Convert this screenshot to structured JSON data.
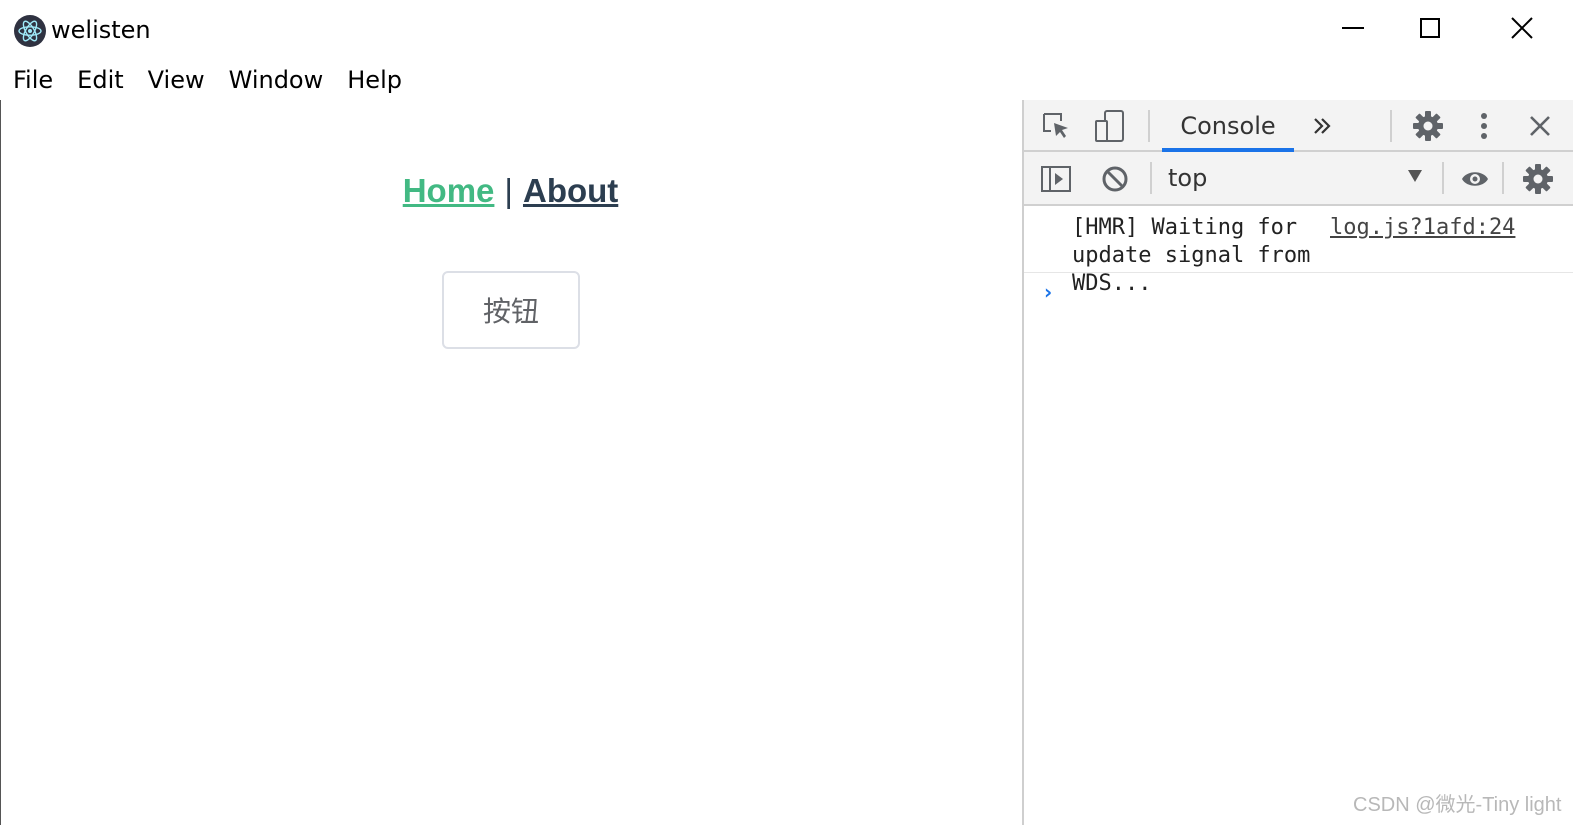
{
  "window": {
    "title": "welisten",
    "icon": "electron-icon",
    "controls": [
      "minimize-icon",
      "maximize-icon",
      "close-icon"
    ]
  },
  "menubar": {
    "items": [
      "File",
      "Edit",
      "View",
      "Window",
      "Help"
    ]
  },
  "app": {
    "nav": {
      "home_label": "Home",
      "separator": "|",
      "about_label": "About"
    },
    "button_label": "按钮",
    "colors": {
      "active_link": "#42b983",
      "text": "#2c3e50"
    }
  },
  "devtools": {
    "tabs": [
      "Console"
    ],
    "active_tab": "Console",
    "more_tabs_icon": "chevrons-right-icon",
    "context": "top",
    "log": {
      "message": "[HMR] Waiting for update signal from WDS...",
      "source": "log.js?1afd:24"
    },
    "prompt_symbol": "›",
    "accent_color": "#1a73e8"
  },
  "watermark": "CSDN @微光-Tiny light"
}
